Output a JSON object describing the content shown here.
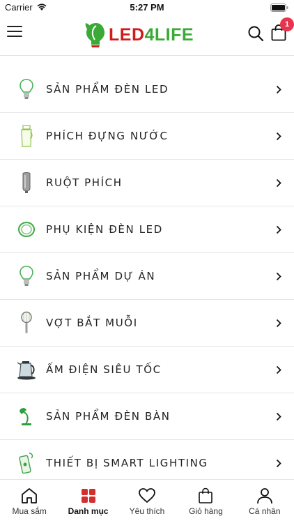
{
  "status": {
    "carrier": "Carrier",
    "time": "5:27 PM"
  },
  "header": {
    "logo_part1": "LED",
    "logo_part2": "4",
    "logo_part3": "LIFE",
    "cart_count": "1"
  },
  "categories": [
    {
      "label": "SẢN PHẨM ĐÈN LED",
      "icon": "led-bulb-icon"
    },
    {
      "label": "PHÍCH ĐỰNG NƯỚC",
      "icon": "thermos-icon"
    },
    {
      "label": "RUỘT PHÍCH",
      "icon": "thermos-liner-icon"
    },
    {
      "label": "PHỤ KIỆN ĐÈN LED",
      "icon": "led-strip-icon"
    },
    {
      "label": "SẢN PHẨM DỰ ÁN",
      "icon": "project-bulb-icon"
    },
    {
      "label": "VỢT BẮT MUỖI",
      "icon": "mosquito-racket-icon"
    },
    {
      "label": "ẤM ĐIỆN SIÊU TỐC",
      "icon": "electric-kettle-icon"
    },
    {
      "label": "SẢN PHẨM ĐÈN BÀN",
      "icon": "desk-lamp-icon"
    },
    {
      "label": "THIẾT BỊ SMART LIGHTING",
      "icon": "smart-lighting-icon"
    }
  ],
  "tabs": [
    {
      "label": "Mua sắm",
      "icon": "home-icon"
    },
    {
      "label": "Danh mục",
      "icon": "grid-icon"
    },
    {
      "label": "Yêu thích",
      "icon": "heart-icon"
    },
    {
      "label": "Giỏ hàng",
      "icon": "bag-icon"
    },
    {
      "label": "Cá nhân",
      "icon": "user-icon"
    }
  ],
  "colors": {
    "brand_red": "#d11a1a",
    "brand_green": "#3aa935",
    "badge": "#e8344e",
    "active_tab": "#d32f2f"
  }
}
